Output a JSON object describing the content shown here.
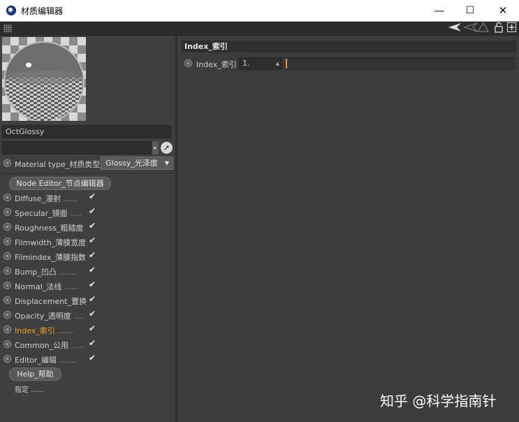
{
  "window": {
    "title": "材质编辑器",
    "minimize": "—",
    "maximize": "☐",
    "close": "✕"
  },
  "material": {
    "name": "OctGlossy",
    "type_label": "Material type_材质类型",
    "type_value": "Glossy_光泽度",
    "node_editor_label": "Node Editor_节点编辑器"
  },
  "channels": [
    {
      "label": "Diffuse_漫射",
      "dots": "......",
      "checked": true,
      "active": false
    },
    {
      "label": "Specular_镜面",
      "dots": ".....",
      "checked": true,
      "active": false
    },
    {
      "label": "Roughness_粗糙度",
      "dots": "",
      "checked": true,
      "active": false
    },
    {
      "label": "Filmwidth_薄膜宽度",
      "dots": "",
      "checked": true,
      "active": false
    },
    {
      "label": "Filmindex_薄膜指数",
      "dots": "",
      "checked": true,
      "active": false
    },
    {
      "label": "Bump_凹凸",
      "dots": ".......",
      "checked": true,
      "active": false
    },
    {
      "label": "Normal_法线",
      "dots": "......",
      "checked": true,
      "active": false
    },
    {
      "label": "Displacement_置换",
      "dots": "",
      "checked": true,
      "active": false
    },
    {
      "label": "Opacity_透明度",
      "dots": "....",
      "checked": true,
      "active": false
    },
    {
      "label": "Index_索引",
      "dots": ".......",
      "checked": true,
      "active": true
    },
    {
      "label": "Common_公用",
      "dots": ".....",
      "checked": true,
      "active": false
    },
    {
      "label": "Editor_编辑",
      "dots": ".......",
      "checked": true,
      "active": false
    }
  ],
  "help_label": "Help_帮助",
  "assign_label": "指定 ......",
  "right": {
    "section_title": "Index_索引",
    "index_label": "Index_索引",
    "index_value": "1."
  },
  "watermark": "知乎 @科学指南针",
  "colors": {
    "active_channel": "#f0a020",
    "slider_fill": "#f0a020",
    "panel_bg": "#3f3f3f"
  },
  "icons": {
    "app": "cinema4d-icon",
    "arrow": "arrow-icon",
    "lock": "lock-icon",
    "add": "add-icon",
    "cursor": "cursor-icon"
  }
}
